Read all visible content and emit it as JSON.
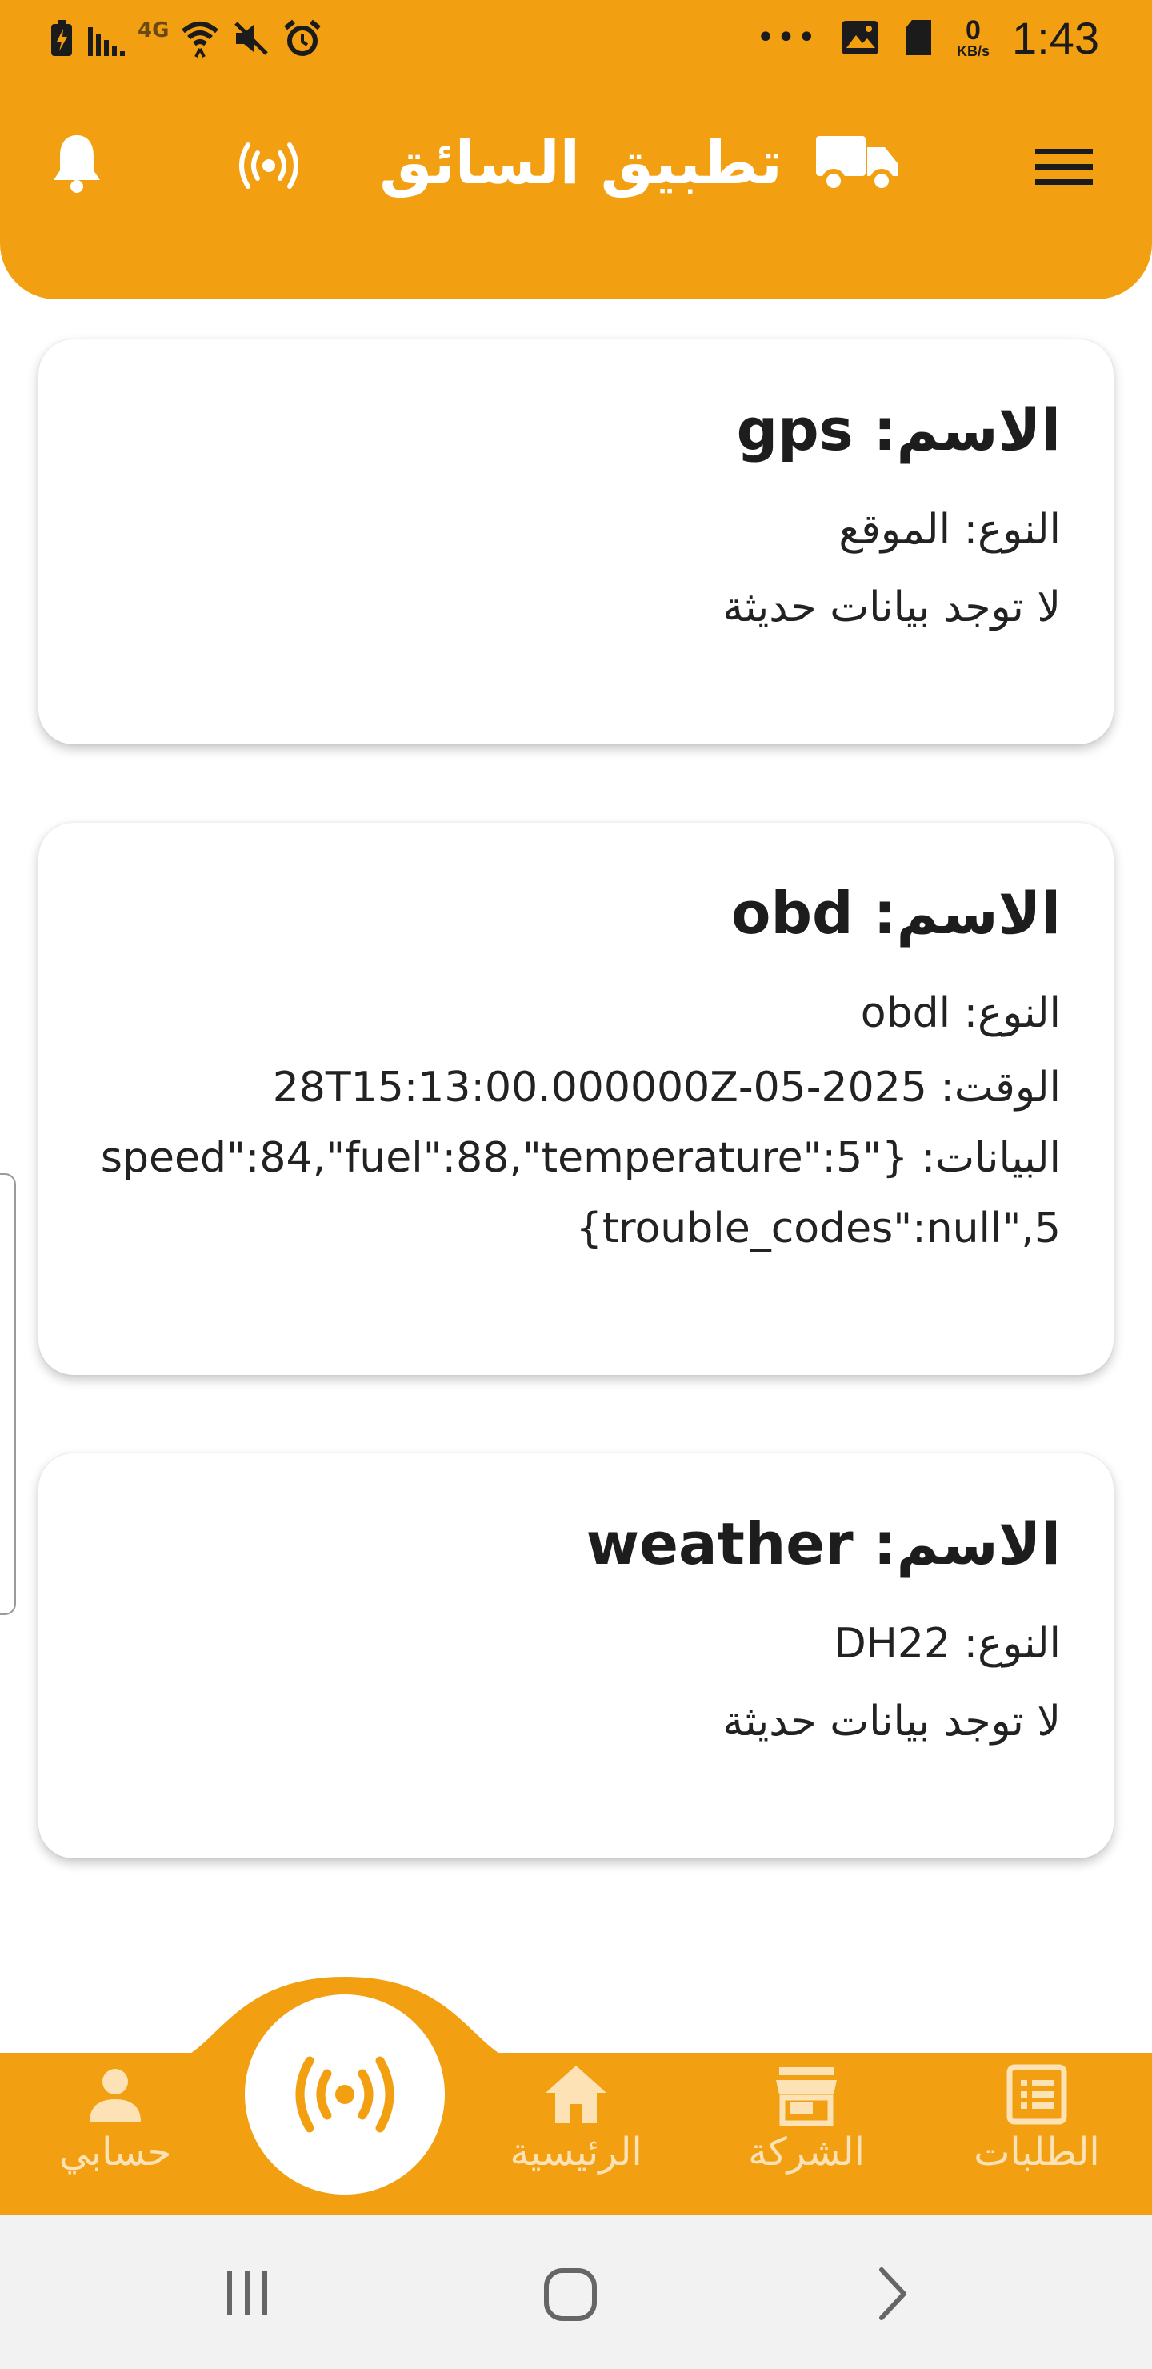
{
  "status_bar": {
    "time": "1:43",
    "dots": "•••",
    "net_speed_value": "0",
    "net_speed_unit": "KB/s",
    "network_badge": "4G"
  },
  "app_bar": {
    "title": "تطبيق السائق",
    "accent_color": "#F29F12",
    "icons": [
      "bell-icon",
      "broadcast-icon",
      "truck-icon",
      "menu-icon"
    ]
  },
  "sensors": [
    {
      "title": "الاسم: gps",
      "type_line": "النوع: الموقع",
      "status": "لا توجد بيانات حديثة"
    },
    {
      "title": "الاسم: obd",
      "type_line": "النوع: obdl",
      "time_line": "الوقت: 2025-05-28T15:13:00.000000Z",
      "data_line_1": "البيانات: {\"speed\":84,\"fuel\":88,\"temperature\":5",
      "data_line_2": "5,\"trouble_codes\":null}"
    },
    {
      "title": "الاسم: weather",
      "type_line": "النوع: DH22",
      "status": "لا توجد بيانات حديثة"
    }
  ],
  "bottom_nav": {
    "items": [
      {
        "label": "حسابي",
        "icon": "person-icon"
      },
      {
        "label": "الرئيسية",
        "icon": "home-icon"
      },
      {
        "label": "الشركة",
        "icon": "store-icon"
      },
      {
        "label": "الطلبات",
        "icon": "orders-icon"
      }
    ],
    "center_icon": "broadcast-icon"
  },
  "system_nav": [
    "recents-button",
    "home-button",
    "back-button"
  ]
}
